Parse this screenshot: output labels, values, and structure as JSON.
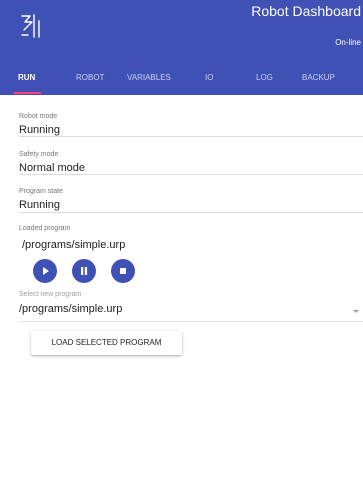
{
  "app": {
    "title": "Robot Dashboard",
    "status": "On-line",
    "logo_icon": "robot-arm-logo-icon",
    "brand_color": "#3f51b5",
    "accent_color": "#ff4081"
  },
  "tabs": [
    {
      "label": "RUN",
      "active": true
    },
    {
      "label": "ROBOT",
      "active": false
    },
    {
      "label": "VARIABLES",
      "active": false
    },
    {
      "label": "IO",
      "active": false
    },
    {
      "label": "LOG",
      "active": false
    },
    {
      "label": "BACKUP",
      "active": false
    }
  ],
  "info": {
    "robot_mode": {
      "label": "Robot mode",
      "value": "Running"
    },
    "safety_mode": {
      "label": "Safety mode",
      "value": "Normal mode"
    },
    "program_state": {
      "label": "Program state",
      "value": "Running"
    },
    "loaded_program": {
      "label": "Loaded program",
      "value": "/programs/simple.urp"
    }
  },
  "controls": [
    {
      "name": "play",
      "icon": "play-icon"
    },
    {
      "name": "pause",
      "icon": "pause-icon"
    },
    {
      "name": "stop",
      "icon": "stop-icon"
    }
  ],
  "program_select": {
    "label": "Select new program",
    "value": "/programs/simple.urp",
    "icon": "chevron-down-icon"
  },
  "load_button": {
    "label": "LOAD SELECTED PROGRAM"
  }
}
